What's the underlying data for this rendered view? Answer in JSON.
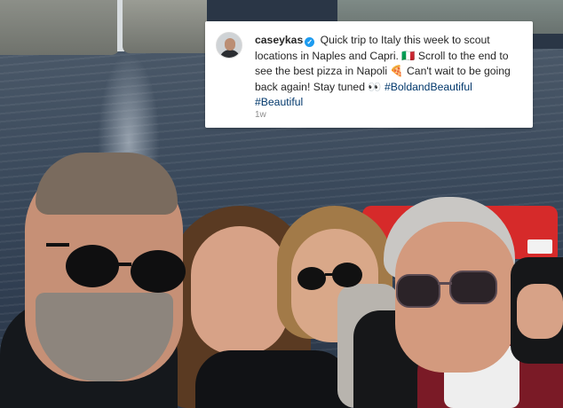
{
  "post": {
    "username": "caseykas",
    "caption_text": "Quick trip to Italy this week to scout locations in Naples and Capri. 🇮🇹 Scroll to the end to see the best pizza in Napoli 🍕 Can't wait to be going back again! Stay tuned 👀",
    "hashtags": [
      "#BoldandBeautiful",
      "#Beautiful"
    ],
    "time_ago": "1w"
  },
  "icons": {
    "verified": "verified-badge-icon",
    "avatar": "profile-avatar"
  },
  "colors": {
    "hashtag": "#00376b",
    "verified": "#1d9bf0",
    "boat": "#d62a2a"
  }
}
